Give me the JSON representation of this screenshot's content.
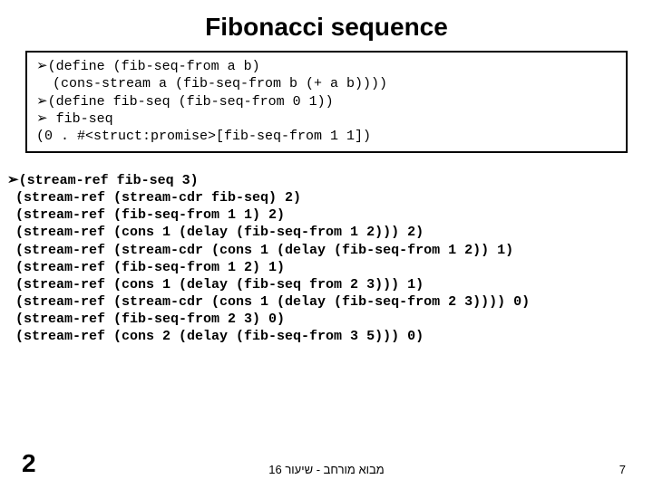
{
  "title": "Fibonacci sequence",
  "box": {
    "l1": "(define (fib-seq-from a b)",
    "l2": "  (cons-stream a (fib-seq-from b (+ a b))))",
    "l3": "(define fib-seq (fib-seq-from 0 1))",
    "l4": " fib-seq",
    "l5": "(0 . #<struct:promise>[fib-seq-from 1 1])"
  },
  "code": {
    "l1": "(stream-ref fib-seq 3)",
    "l2": " (stream-ref (stream-cdr fib-seq) 2)",
    "l3": " (stream-ref (fib-seq-from 1 1) 2)",
    "l4": " (stream-ref (cons 1 (delay (fib-seq-from 1 2))) 2)",
    "l5": " (stream-ref (stream-cdr (cons 1 (delay (fib-seq-from 1 2)) 1)",
    "l6": " (stream-ref (fib-seq-from 1 2) 1)",
    "l7": " (stream-ref (cons 1 (delay (fib-seq from 2 3))) 1)",
    "l8": " (stream-ref (stream-cdr (cons 1 (delay (fib-seq-from 2 3)))) 0)",
    "l9": " (stream-ref (fib-seq-from 2 3) 0)",
    "l10": " (stream-ref (cons 2 (delay (fib-seq-from 3 5))) 0)"
  },
  "result": "2",
  "footer": "מבוא מורחב - שיעור 16",
  "pagenum": "7",
  "arrow": "➢"
}
